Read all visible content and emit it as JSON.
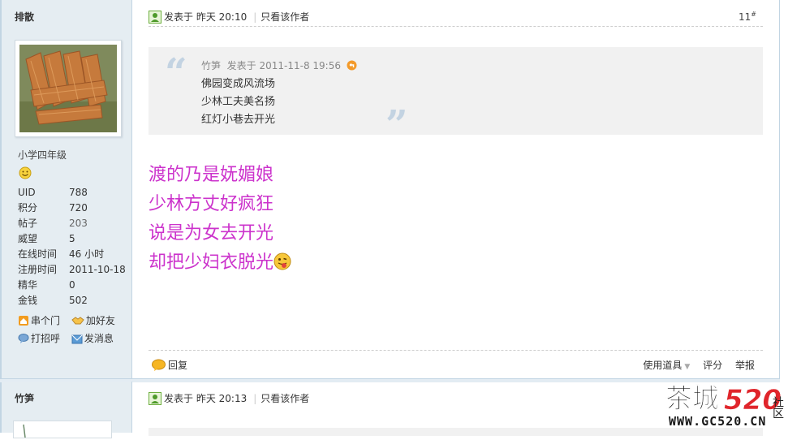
{
  "post1": {
    "author": "排散",
    "rank": "小学四年级",
    "stats": [
      {
        "label": "UID",
        "value": "788"
      },
      {
        "label": "积分",
        "value": "720"
      },
      {
        "label": "帖子",
        "value": "203"
      },
      {
        "label": "威望",
        "value": "5"
      },
      {
        "label": "在线时间",
        "value": "46 小时"
      },
      {
        "label": "注册时间",
        "value": "2011-10-18"
      },
      {
        "label": "精华",
        "value": "0"
      },
      {
        "label": "金钱",
        "value": "502"
      }
    ],
    "actions": {
      "visit": "串个门",
      "add_friend": "加好友",
      "greet": "打招呼",
      "message": "发消息"
    },
    "header": {
      "posted_at": "发表于  昨天 20:10",
      "only_author": "只看该作者",
      "floor": "11",
      "floor_mark": "#"
    },
    "quote": {
      "author": "竹笋",
      "posted_at": "发表于  2011-11-8 19:56",
      "lines": [
        "佛园变成风流场",
        "少林工夫美名扬",
        "红灯小巷去开光"
      ]
    },
    "body_lines": [
      "渡的乃是妩媚娘",
      "少林方丈好疯狂",
      "说是为女去开光",
      "却把少妇衣脱光"
    ],
    "footer": {
      "reply": "回复",
      "tools": "使用道具",
      "rate": "评分",
      "report": "举报"
    }
  },
  "post2": {
    "author": "竹笋",
    "header": {
      "posted_at": "发表于  昨天 20:13",
      "only_author": "只看该作者"
    }
  },
  "watermark": {
    "brand": "茶城",
    "number": "520",
    "domain": "WWW.GC520.CN",
    "tag": "社区"
  },
  "colors": {
    "sidebar": "#e5edf2",
    "border": "#c2d5e3",
    "poem": "#cc33cc",
    "quote_bg": "#f1f1f1"
  }
}
